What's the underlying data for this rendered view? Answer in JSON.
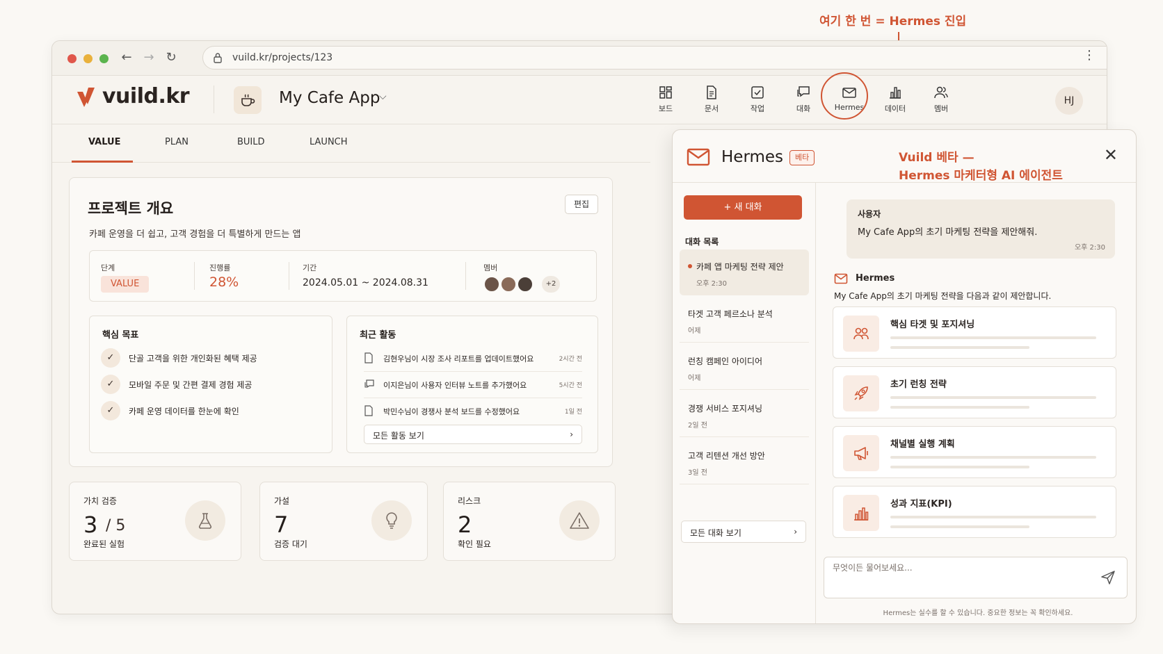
{
  "annotations": {
    "top": "여기 한 번 = Hermes 진입",
    "side_line1": "Vuild 베타 —",
    "side_line2": "Hermes 마케터형 AI 에이전트"
  },
  "browser": {
    "url": "vuild.kr/projects/123"
  },
  "header": {
    "logo": "vuild.kr",
    "project_name": "My Cafe App",
    "nav": [
      {
        "label": "보드",
        "icon": "board-icon"
      },
      {
        "label": "문서",
        "icon": "document-icon"
      },
      {
        "label": "작업",
        "icon": "task-icon"
      },
      {
        "label": "대화",
        "icon": "chat-icon"
      },
      {
        "label": "Hermes",
        "icon": "mail-icon"
      },
      {
        "label": "데이터",
        "icon": "bar-chart-icon"
      },
      {
        "label": "멤버",
        "icon": "members-icon"
      }
    ],
    "avatar_initials": "HJ"
  },
  "tabs": [
    "VALUE",
    "PLAN",
    "BUILD",
    "LAUNCH"
  ],
  "overview": {
    "title": "프로젝트 개요",
    "edit": "편집",
    "description": "카페 운영을 더 쉽고, 고객 경험을 더 특별하게 만드는 앱",
    "stage_label": "단계",
    "stage_value": "VALUE",
    "progress_label": "진행률",
    "progress_value": "28%",
    "period_label": "기간",
    "period_value": "2024.05.01 ~ 2024.08.31",
    "members_label": "멤버",
    "members_more": "+2",
    "goals_title": "핵심 목표",
    "goals": [
      "단골 고객을 위한 개인화된 혜택 제공",
      "모바일 주문 및 간편 결제 경험 제공",
      "카페 운영 데이터를 한눈에 확인"
    ],
    "activity_title": "최근 활동",
    "activities": [
      {
        "text": "김현우님이 시장 조사 리포트를 업데이트했어요",
        "time": "2시간 전",
        "icon": "document-icon"
      },
      {
        "text": "이지은님이 사용자 인터뷰 노트를 추가했어요",
        "time": "5시간 전",
        "icon": "chat-icon"
      },
      {
        "text": "박민수님이 경쟁사 분석 보드를 수정했어요",
        "time": "1일 전",
        "icon": "document-icon"
      }
    ],
    "activity_all": "모든 활동 보기"
  },
  "metrics": [
    {
      "label": "가치 검증",
      "value": "3",
      "of": "/ 5",
      "sub": "완료된 실험",
      "icon": "flask-icon"
    },
    {
      "label": "가설",
      "value": "7",
      "of": "",
      "sub": "검증 대기",
      "icon": "lightbulb-icon"
    },
    {
      "label": "리스크",
      "value": "2",
      "of": "",
      "sub": "확인 필요",
      "icon": "warning-icon"
    }
  ],
  "hermes": {
    "title": "Hermes",
    "beta": "베타",
    "new_chat": "+  새 대화",
    "list_title": "대화 목록",
    "chats": [
      {
        "title": "카페 앱 마케팅 전략 제안",
        "time": "오후 2:30"
      },
      {
        "title": "타겟 고객 페르소나 분석",
        "time": "어제"
      },
      {
        "title": "런칭 캠페인 아이디어",
        "time": "어제"
      },
      {
        "title": "경쟁 서비스 포지셔닝",
        "time": "2일 전"
      },
      {
        "title": "고객 리텐션 개선 방안",
        "time": "3일 전"
      }
    ],
    "all_chats": "모든 대화 보기",
    "user_name": "사용자",
    "user_message": "My Cafe App의 초기 마케팅 전략을 제안해줘.",
    "user_time": "오후 2:30",
    "reply_sender": "Hermes",
    "reply_intro": "My Cafe App의 초기 마케팅 전략을 다음과 같이 제안합니다.",
    "recommendations": [
      {
        "title": "핵심 타겟 및 포지셔닝",
        "icon": "people-icon"
      },
      {
        "title": "초기 런칭 전략",
        "icon": "rocket-icon"
      },
      {
        "title": "채널별 실행 계획",
        "icon": "megaphone-icon"
      },
      {
        "title": "성과 지표(KPI)",
        "icon": "bar-chart-icon"
      }
    ],
    "input_placeholder": "무엇이든 물어보세요...",
    "disclaimer": "Hermes는 실수를 할 수 있습니다. 중요한 정보는 꼭 확인하세요."
  },
  "colors": {
    "accent": "#d05533",
    "background": "#faf8f4"
  }
}
